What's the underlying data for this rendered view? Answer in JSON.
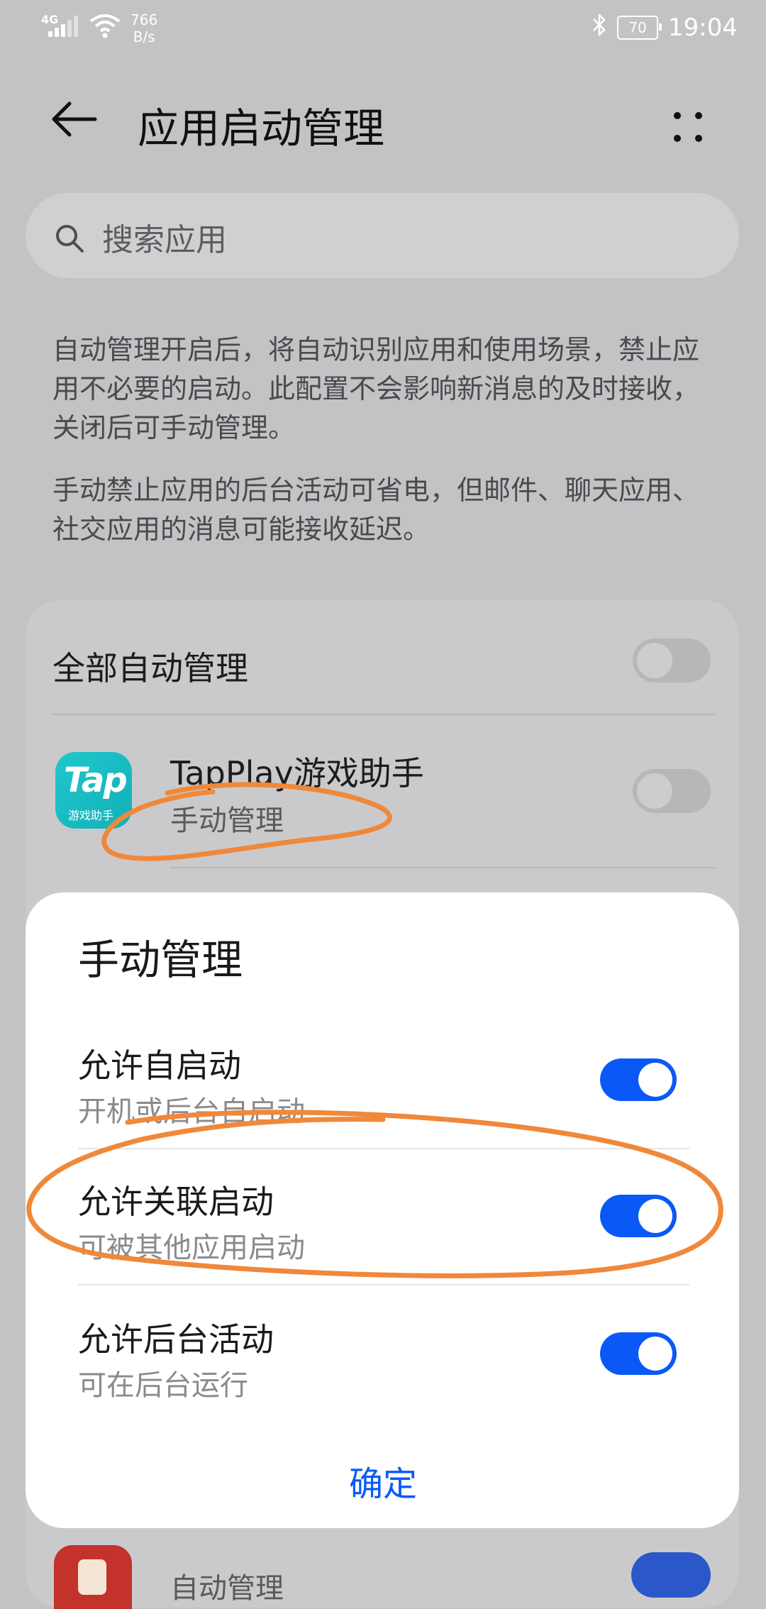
{
  "status_bar": {
    "network": "4G",
    "speed_value": "766",
    "speed_unit": "B/s",
    "battery": "70",
    "time": "19:04",
    "icons": [
      "signal-icon",
      "wifi-icon",
      "bluetooth-icon",
      "battery-icon"
    ]
  },
  "header": {
    "title": "应用启动管理",
    "back_icon": "back-arrow-icon",
    "more_icon": "more-icon"
  },
  "search": {
    "placeholder": "搜索应用"
  },
  "description": {
    "paragraph1": "自动管理开启后，将自动识别应用和使用场景，禁止应用不必要的启动。此配置不会影响新消息的及时接收，关闭后可手动管理。",
    "paragraph2": "手动禁止应用的后台活动可省电，但邮件、聊天应用、社交应用的消息可能接收延迟。"
  },
  "list": {
    "all_auto_label": "全部自动管理",
    "all_auto_on": false,
    "apps": [
      {
        "name": "TapPlay游戏助手",
        "status": "手动管理",
        "icon_text": "Tap",
        "icon_subtext": "游戏助手",
        "enabled": false
      },
      {
        "name": "",
        "status": "自动管理",
        "enabled": true
      }
    ]
  },
  "dialog": {
    "title": "手动管理",
    "options": [
      {
        "label": "允许自启动",
        "sub": "开机或后台自启动",
        "on": true
      },
      {
        "label": "允许关联启动",
        "sub": "可被其他应用启动",
        "on": true
      },
      {
        "label": "允许后台活动",
        "sub": "可在后台运行",
        "on": true
      }
    ],
    "confirm_label": "确定"
  },
  "colors": {
    "accent": "#0a59f7",
    "annotation": "#f0883a",
    "app_icon": "#1fc7cc"
  }
}
